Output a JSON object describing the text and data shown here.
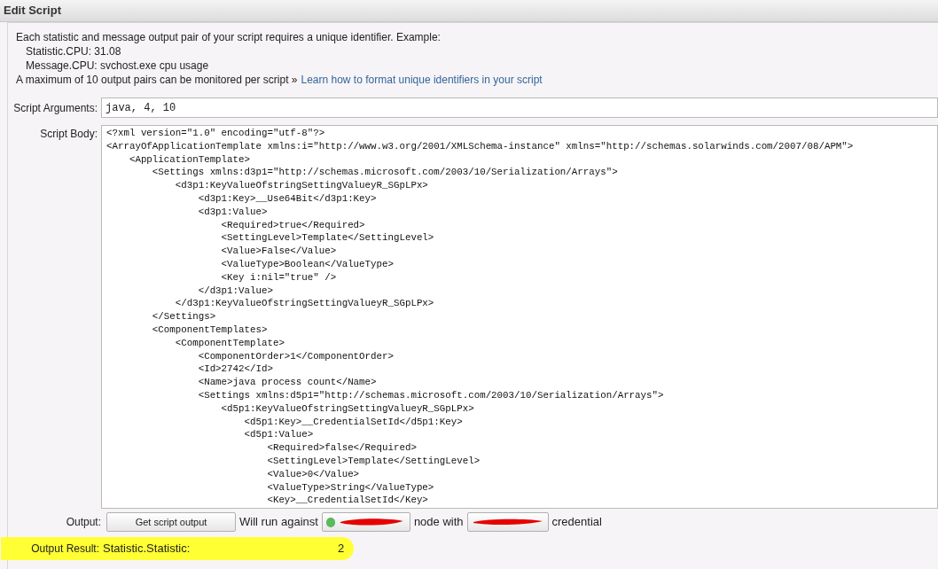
{
  "window": {
    "title": "Edit Script"
  },
  "intro": {
    "lead": "Each statistic and message output pair of your script requires a unique identifier. Example:",
    "examples": [
      "Statistic.CPU: 31.08",
      "Message.CPU: svchost.exe cpu usage"
    ],
    "limit": "A maximum of 10 output pairs can be monitored per script »",
    "link": "Learn how to format unique identifiers in your script"
  },
  "arguments": {
    "label": "Script Arguments:",
    "value": "java, 4, 10"
  },
  "body": {
    "label": "Script Body:",
    "lines": [
      "<?xml version=\"1.0\" encoding=\"utf-8\"?>",
      "<ArrayOfApplicationTemplate xmlns:i=\"http://www.w3.org/2001/XMLSchema-instance\" xmlns=\"http://schemas.solarwinds.com/2007/08/APM\">",
      "    <ApplicationTemplate>",
      "        <Settings xmlns:d3p1=\"http://schemas.microsoft.com/2003/10/Serialization/Arrays\">",
      "            <d3p1:KeyValueOfstringSettingValueyR_SGpLPx>",
      "                <d3p1:Key>__Use64Bit</d3p1:Key>",
      "                <d3p1:Value>",
      "                    <Required>true</Required>",
      "                    <SettingLevel>Template</SettingLevel>",
      "                    <Value>False</Value>",
      "                    <ValueType>Boolean</ValueType>",
      "                    <Key i:nil=\"true\" />",
      "                </d3p1:Value>",
      "            </d3p1:KeyValueOfstringSettingValueyR_SGpLPx>",
      "        </Settings>",
      "        <ComponentTemplates>",
      "            <ComponentTemplate>",
      "                <ComponentOrder>1</ComponentOrder>",
      "                <Id>2742</Id>",
      "                <Name>java process count</Name>",
      "                <Settings xmlns:d5p1=\"http://schemas.microsoft.com/2003/10/Serialization/Arrays\">",
      "                    <d5p1:KeyValueOfstringSettingValueyR_SGpLPx>",
      "                        <d5p1:Key>__CredentialSetId</d5p1:Key>",
      "                        <d5p1:Value>",
      "                            <Required>false</Required>",
      "                            <SettingLevel>Template</SettingLevel>",
      "                            <Value>0</Value>",
      "                            <ValueType>String</ValueType>",
      "                            <Key>__CredentialSetId</Key>"
    ]
  },
  "output": {
    "label": "Output:",
    "button": "Get script output",
    "run_text": "Will run against",
    "node_with": "node with",
    "credential": "credential",
    "node_up": true
  },
  "result": {
    "label": "Output Result:",
    "name": "Statistic.Statistic:",
    "value": "2"
  }
}
